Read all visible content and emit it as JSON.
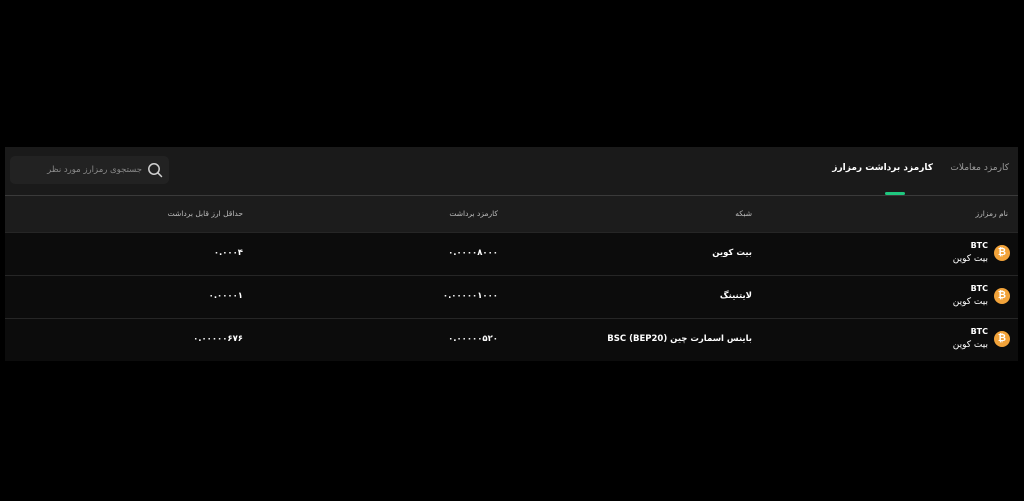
{
  "tabs": {
    "trade_fees": "کارمزد معاملات",
    "withdraw_fees": "کارمزد برداشت رمزارز"
  },
  "search": {
    "placeholder": "جستجوی رمزارز مورد نظر"
  },
  "table": {
    "headers": {
      "name": "نام رمزارز",
      "network": "شبکه",
      "fee": "کارمزد برداشت",
      "min": "حداقل ارز قابل برداشت"
    },
    "rows": [
      {
        "symbol": "BTC",
        "name": "بیت کوین",
        "network": "بیت کوین",
        "fee": "۰.۰۰۰۰۸۰۰۰",
        "min": "۰.۰۰۰۴"
      },
      {
        "symbol": "BTC",
        "name": "بیت کوین",
        "network": "لایتنینگ",
        "fee": "۰.۰۰۰۰۰۱۰۰۰",
        "min": "۰.۰۰۰۰۱"
      },
      {
        "symbol": "BTC",
        "name": "بیت کوین",
        "network": "باینس اسمارت چین (BEP20) BSC",
        "fee": "۰.۰۰۰۰۰۵۲۰",
        "min": "۰.۰۰۰۰۰۶۷۶"
      }
    ]
  },
  "colors": {
    "accent": "#1fc77f",
    "coin": "#f2a33a"
  },
  "icons": {
    "search": "search-icon",
    "coin": "bitcoin-icon"
  }
}
